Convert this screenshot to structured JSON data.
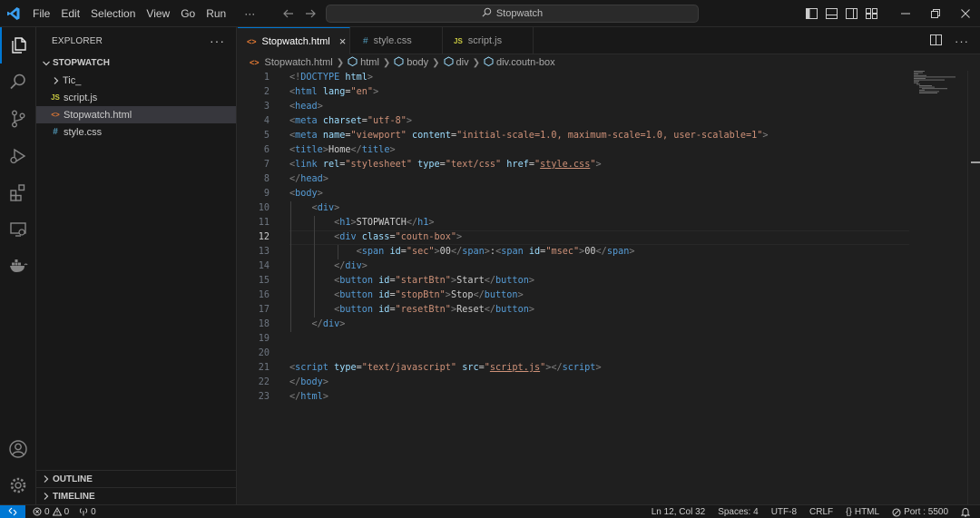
{
  "menu": [
    "File",
    "Edit",
    "Selection",
    "View",
    "Go",
    "Run",
    "···"
  ],
  "search": {
    "text": "Stopwatch"
  },
  "sidebar": {
    "title": "EXPLORER",
    "more": "···",
    "folder": "STOPWATCH",
    "items": [
      {
        "label": "Tic_",
        "kind": "folder"
      },
      {
        "label": "script.js",
        "kind": "js",
        "icon_text": "JS"
      },
      {
        "label": "Stopwatch.html",
        "kind": "html",
        "icon_text": "<>"
      },
      {
        "label": "style.css",
        "kind": "css",
        "icon_text": "#"
      }
    ],
    "outline": "OUTLINE",
    "timeline": "TIMELINE"
  },
  "tabs": [
    {
      "label": "Stopwatch.html",
      "icon_text": "<>",
      "active": true,
      "close": "×"
    },
    {
      "label": "style.css",
      "icon_text": "#",
      "active": false
    },
    {
      "label": "script.js",
      "icon_text": "JS",
      "active": false
    }
  ],
  "breadcrumb": [
    "Stopwatch.html",
    "html",
    "body",
    "div",
    "div.coutn-box"
  ],
  "editor": {
    "line_numbers": [
      "1",
      "2",
      "3",
      "4",
      "5",
      "6",
      "7",
      "8",
      "9",
      "10",
      "11",
      "12",
      "13",
      "14",
      "15",
      "16",
      "17",
      "18",
      "19",
      "20",
      "21",
      "22",
      "23"
    ],
    "current_line": 12
  },
  "status": {
    "errors": "0",
    "warnings": "0",
    "ports": "0",
    "position": "Ln 12, Col 32",
    "spaces": "Spaces: 4",
    "encoding": "UTF-8",
    "eol": "CRLF",
    "language": "HTML",
    "port": "Port : 5500"
  },
  "colors": {
    "accent": "#0078d4",
    "html_icon": "#e37933",
    "js_icon": "#cbcb41",
    "css_icon": "#519aba",
    "tag": "#569cd6",
    "attr": "#9cdcfe",
    "string": "#ce9178"
  }
}
